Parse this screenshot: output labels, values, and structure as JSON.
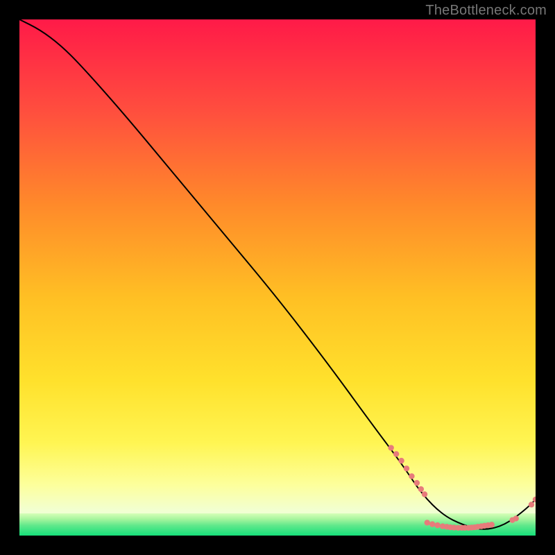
{
  "watermark": "TheBottleneck.com",
  "chart_data": {
    "type": "line",
    "title": "",
    "xlabel": "",
    "ylabel": "",
    "xlim": [
      0,
      100
    ],
    "ylim": [
      0,
      100
    ],
    "grid": false,
    "background_gradient": {
      "top": "#ff1a48",
      "mid1": "#ff8a2a",
      "mid2": "#ffd828",
      "mid3": "#fff960",
      "low": "#f8ffbd",
      "green_start": "#9bf0a6",
      "green_end": "#17e87a"
    },
    "series": [
      {
        "name": "bottleneck-curve",
        "color": "#000000",
        "x": [
          0,
          4,
          8,
          12,
          20,
          30,
          40,
          50,
          60,
          68,
          74,
          78,
          82,
          86,
          90,
          94,
          98,
          100
        ],
        "y": [
          100,
          98,
          95,
          91,
          82,
          70,
          58,
          46,
          33,
          22,
          14,
          8,
          4,
          2,
          1,
          2,
          5,
          7
        ]
      },
      {
        "name": "markers-upper-cluster",
        "type": "scatter",
        "color": "#e77b7b",
        "x": [
          72,
          73,
          74,
          75,
          76,
          77,
          77.8,
          78.5
        ],
        "y": [
          17,
          15.8,
          14.5,
          13,
          11.5,
          10.2,
          9,
          8
        ]
      },
      {
        "name": "markers-flat-cluster",
        "type": "scatter",
        "color": "#e77b7b",
        "x": [
          79,
          80,
          81,
          82,
          82.8,
          83.5,
          84.2,
          85,
          85.7,
          86.3,
          87,
          87.6,
          88.2,
          88.8,
          89.5,
          90.1,
          90.8,
          91.5
        ],
        "y": [
          2.5,
          2.2,
          2,
          1.8,
          1.7,
          1.6,
          1.55,
          1.5,
          1.5,
          1.5,
          1.5,
          1.55,
          1.6,
          1.7,
          1.8,
          1.9,
          2.0,
          2.1
        ]
      },
      {
        "name": "markers-tail-cluster",
        "type": "scatter",
        "color": "#e77b7b",
        "x": [
          95.5,
          96.2,
          99.2,
          100
        ],
        "y": [
          3.0,
          3.3,
          6.0,
          7.0
        ]
      }
    ]
  }
}
